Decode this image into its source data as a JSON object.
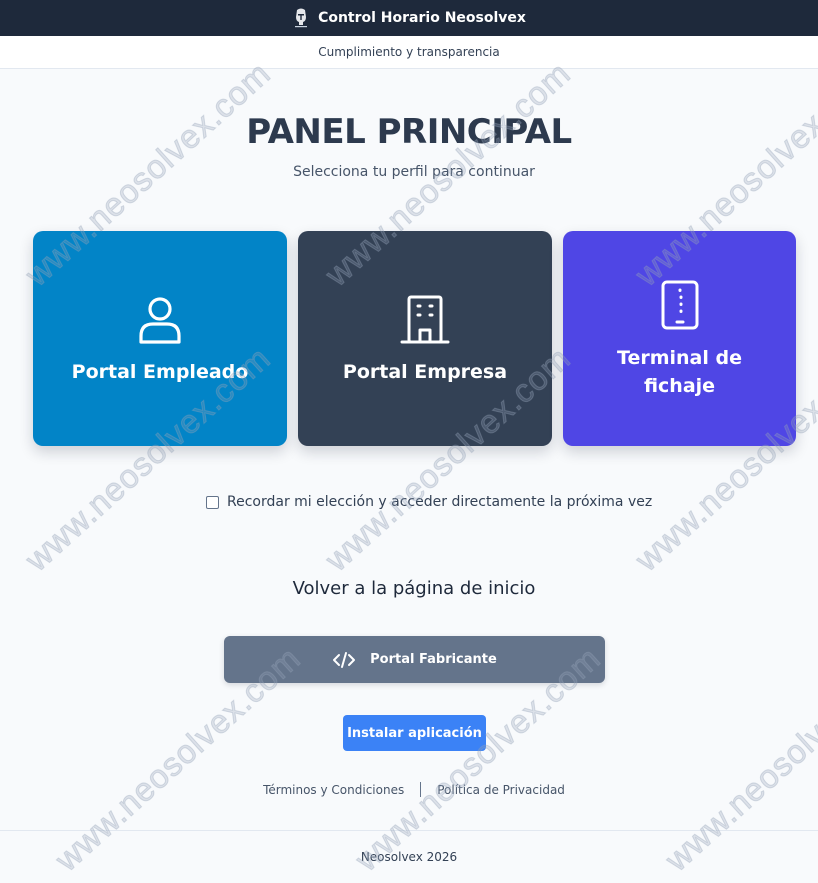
{
  "header": {
    "title": "Control Horario Neosolvex",
    "logo_icon": "knight-helmet-icon",
    "subtitle": "Cumplimiento y transparencia"
  },
  "main": {
    "title": "PANEL PRINCIPAL",
    "subtitle": "Selecciona tu perfil para continuar",
    "cards": [
      {
        "label": "Portal Empleado",
        "icon": "user-icon",
        "color": "#0284c7"
      },
      {
        "label": "Portal Empresa",
        "icon": "building-icon",
        "color": "#334155"
      },
      {
        "label": "Terminal de fichaje",
        "icon": "tablet-icon",
        "color": "#4f46e5"
      }
    ],
    "remember_label": "Recordar mi elección y acceder directamente la próxima vez",
    "remember_checked": false,
    "back_home": "Volver a la página de inicio",
    "maker_button": {
      "label": "Portal Fabricante",
      "icon": "code-icon",
      "color": "#64748b"
    },
    "install_button": {
      "label": "Instalar aplicación",
      "color": "#3b82f6"
    }
  },
  "legal": {
    "terms": "Términos y Condiciones",
    "privacy": "Política de Privacidad"
  },
  "footer": {
    "text": "Neosolvex 2026"
  },
  "watermark": {
    "text": "www.neosolvex.com"
  }
}
